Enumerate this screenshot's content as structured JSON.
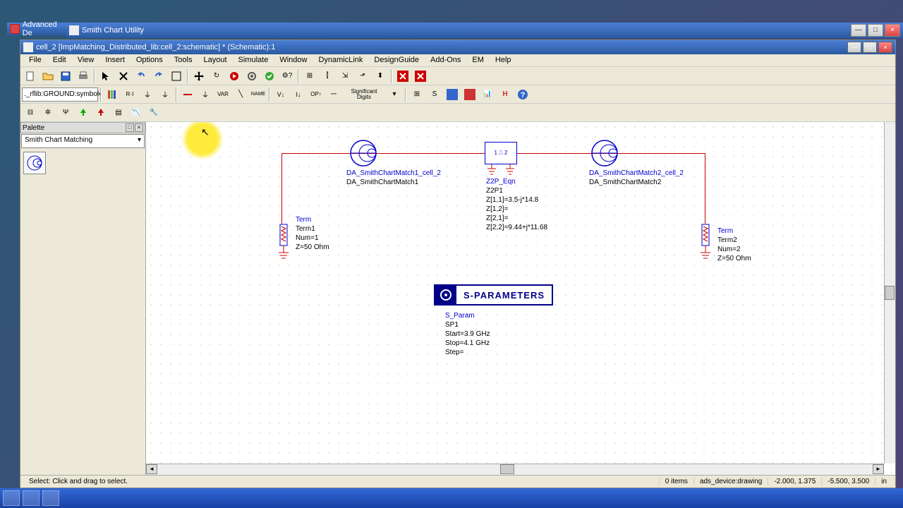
{
  "outer_title": "Advanced De",
  "utility_window_title": "Smith Chart Utility",
  "schematic_title": "cell_2 [ImpMatching_Distributed_lib:cell_2:schematic] * (Schematic):1",
  "menu": {
    "file": "File",
    "edit": "Edit",
    "view": "View",
    "insert": "Insert",
    "options": "Options",
    "tools": "Tools",
    "layout": "Layout",
    "simulate": "Simulate",
    "window": "Window",
    "dynamiclink": "DynamicLink",
    "designguide": "DesignGuide",
    "addons": "Add-Ons",
    "em": "EM",
    "help": "Help"
  },
  "toolbar2_combo": "._rflib:GROUND:symbol",
  "toolbar2_sigdigits": "Significant\nDigits",
  "toolbar2_var": "VAR",
  "toolbar2_name": "NAME",
  "palette": {
    "title": "Palette",
    "combo": "Smith Chart Matching"
  },
  "schematic": {
    "match1": {
      "type": "DA_SmithChartMatch1_cell_2",
      "inst": "DA_SmithChartMatch1"
    },
    "match2": {
      "type": "DA_SmithChartMatch2_cell_2",
      "inst": "DA_SmithChartMatch2"
    },
    "z2p": {
      "type": "Z2P_Eqn",
      "inst": "Z2P1",
      "z11": "Z[1,1]=3.5-j*14.8",
      "z12": "Z[1,2]=",
      "z21": "Z[2,1]=",
      "z22": "Z[2,2]=9.44+j*11.68"
    },
    "term1": {
      "type": "Term",
      "inst": "Term1",
      "num": "Num=1",
      "z": "Z=50 Ohm"
    },
    "term2": {
      "type": "Term",
      "inst": "Term2",
      "num": "Num=2",
      "z": "Z=50 Ohm"
    },
    "sparam": {
      "header": "S-PARAMETERS",
      "type": "S_Param",
      "inst": "SP1",
      "start": "Start=3.9 GHz",
      "stop": "Stop=4.1 GHz",
      "step": "Step="
    }
  },
  "statusbar": {
    "hint": "Select: Click and drag to select.",
    "items": "0 items",
    "layer": "ads_device:drawing",
    "coord1": "-2.000, 1.375",
    "coord2": "-5.500, 3.500",
    "unit": "in"
  }
}
